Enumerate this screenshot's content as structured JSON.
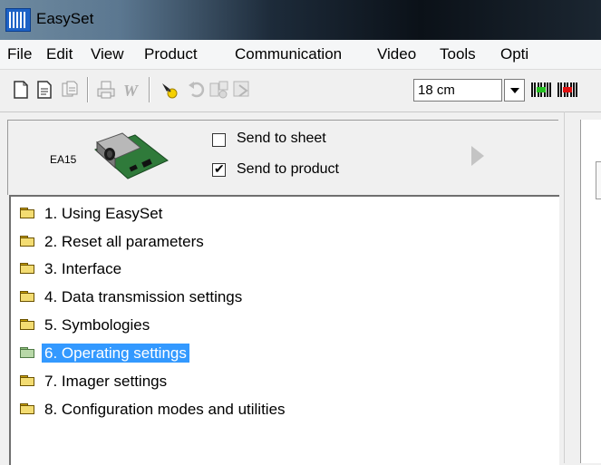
{
  "window": {
    "title": "EasySet",
    "icon": "easyset-barcode-icon"
  },
  "menu": [
    "File",
    "Edit",
    "View",
    "Product",
    "Communication",
    "Video",
    "Tools",
    "Opti"
  ],
  "toolbar": {
    "zoom_value": "18 cm",
    "icons": [
      "new-document-icon",
      "open-document-icon",
      "copy-document-icon",
      "print-icon",
      "word-export-icon",
      "flashlight-icon",
      "undo-icon",
      "scan-icon",
      "send-icon",
      "barcode-green-icon",
      "barcode-red-icon"
    ]
  },
  "product": {
    "name": "EA15",
    "send_to_sheet": {
      "label": "Send to sheet",
      "checked": false
    },
    "send_to_product": {
      "label": "Send to product",
      "checked": true
    }
  },
  "tree": {
    "items": [
      {
        "label": "1. Using EasySet",
        "selected": false
      },
      {
        "label": "2. Reset all parameters",
        "selected": false
      },
      {
        "label": "3. Interface",
        "selected": false
      },
      {
        "label": "4. Data transmission settings",
        "selected": false
      },
      {
        "label": "5. Symbologies",
        "selected": false
      },
      {
        "label": "6. Operating settings",
        "selected": true
      },
      {
        "label": "7. Imager settings",
        "selected": false
      },
      {
        "label": "8. Configuration modes and utilities",
        "selected": false
      }
    ]
  },
  "colors": {
    "selection": "#3399ff",
    "folder": "#f3dc72",
    "folder_selected": "#b8d8a8"
  }
}
